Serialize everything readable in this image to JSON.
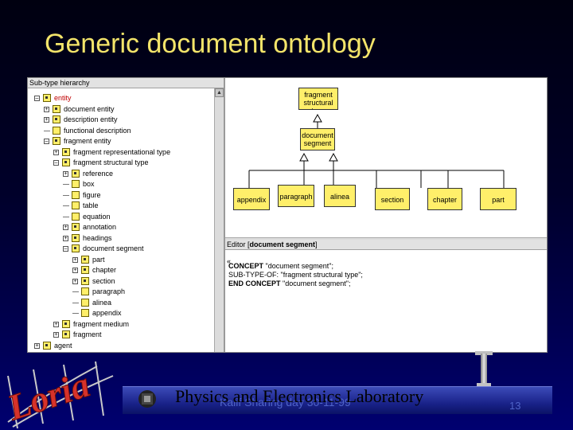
{
  "slide": {
    "title": "Generic document ontology"
  },
  "tree_panel": {
    "title": "Sub-type hierarchy",
    "scroll_up": "▲",
    "items": [
      {
        "label": "entity",
        "red": true
      },
      {
        "label": "document entity",
        "red": false
      },
      {
        "label": "description entity",
        "red": false
      },
      {
        "label": "functional description",
        "red": false
      },
      {
        "label": "fragment entity",
        "red": false
      },
      {
        "label": "fragment representational type",
        "red": false
      },
      {
        "label": "fragment structural type",
        "red": false
      },
      {
        "label": "reference",
        "red": false
      },
      {
        "label": "box",
        "red": false
      },
      {
        "label": "figure",
        "red": false
      },
      {
        "label": "table",
        "red": false
      },
      {
        "label": "equation",
        "red": false
      },
      {
        "label": "annotation",
        "red": false
      },
      {
        "label": "headings",
        "red": false
      },
      {
        "label": "document segment",
        "red": false
      },
      {
        "label": "part",
        "red": false
      },
      {
        "label": "chapter",
        "red": false
      },
      {
        "label": "section",
        "red": false
      },
      {
        "label": "paragraph",
        "red": false
      },
      {
        "label": "alinea",
        "red": false
      },
      {
        "label": "appendix",
        "red": false
      },
      {
        "label": "fragment medium",
        "red": false
      },
      {
        "label": "fragment",
        "red": false
      },
      {
        "label": "agent",
        "red": false
      }
    ]
  },
  "diagram": {
    "top_box": "fragment structural type",
    "middle_box": "document segment",
    "leaves": [
      "appendix",
      "paragraph",
      "alinea",
      "section",
      "chapter",
      "part"
    ]
  },
  "editor": {
    "title_prefix": "Editor [",
    "title_bold": "document segment",
    "title_suffix": "]",
    "caret": "«",
    "lines": [
      {
        "kw": "CONCEPT",
        "rest": " \"document segment\";"
      },
      {
        "kw": "",
        "rest": "  SUB-TYPE-OF: \"fragment structural type\";"
      },
      {
        "kw": "END CONCEPT",
        "rest": " \"document segment\";"
      }
    ]
  },
  "footer": {
    "subtitle": "Kalif Sharing day 30-11-99",
    "lab": "Physics and Electronics Laboratory",
    "page_number": "13",
    "logo_text": "Loria"
  },
  "colors": {
    "title": "#f3e46a",
    "concept_fill": "#ffef6a",
    "highlight_red": "#c00000",
    "logo_red": "#d7322a",
    "logo_frame": "#c9c9c9"
  }
}
